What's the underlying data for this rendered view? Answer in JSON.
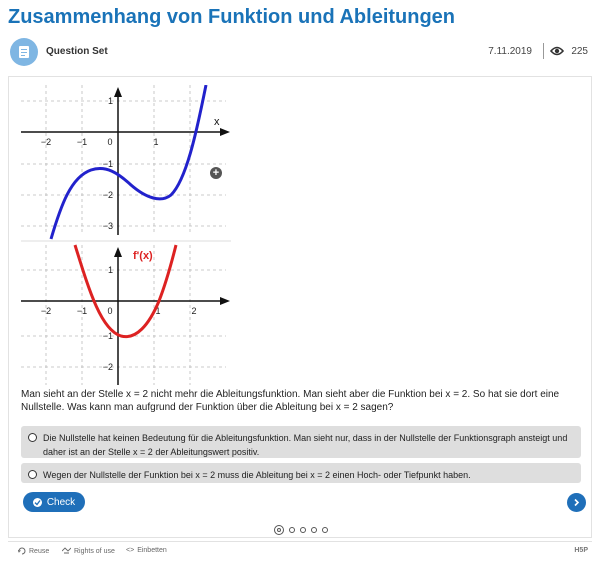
{
  "page": {
    "title": "Zusammenhang von Funktion und Ableitungen"
  },
  "header": {
    "content_type": "Question Set",
    "date": "7.11.2019",
    "views": "225"
  },
  "figure": {
    "top_x_ticks": [
      "−2",
      "−1",
      "0",
      "1"
    ],
    "top_y_ticks": [
      "1",
      "−1",
      "−2",
      "−3"
    ],
    "top_x_label": "x",
    "bottom_label": "f'(x)",
    "bottom_x_ticks": [
      "−2",
      "−1",
      "0",
      "1",
      "2"
    ],
    "bottom_y_ticks": [
      "1",
      "−1",
      "−2"
    ],
    "function_color": "#2222cc",
    "derivative_color": "#dd2222"
  },
  "question": "Man sieht an der Stelle x = 2 nicht mehr die Ableitungsfunktion. Man sieht aber die Funktion bei x = 2. So hat sie dort eine Nullstelle. Was kann man aufgrund der Funktion über die Ableitung bei x = 2 sagen?",
  "answers": [
    {
      "text": "Die Nullstelle hat keinen Bedeutung für die Ableitungsfunktion. Man sieht nur, dass in der Nullstelle der Funktionsgraph ansteigt und daher ist an der Stelle x = 2 der Ableitungswert positiv."
    },
    {
      "text": "Wegen der Nullstelle der Funktion bei x = 2 muss die Ableitung bei x = 2 einen Hoch- oder Tiefpunkt haben."
    }
  ],
  "buttons": {
    "check": "Check"
  },
  "pagination": {
    "total": 5,
    "current": 1
  },
  "footer": {
    "reuse": "Reuse",
    "rights": "Rights of use",
    "embed": "Einbetten",
    "brand": "H5P"
  },
  "colors": {
    "accent": "#1f6fb9",
    "title": "#1a73b8"
  }
}
